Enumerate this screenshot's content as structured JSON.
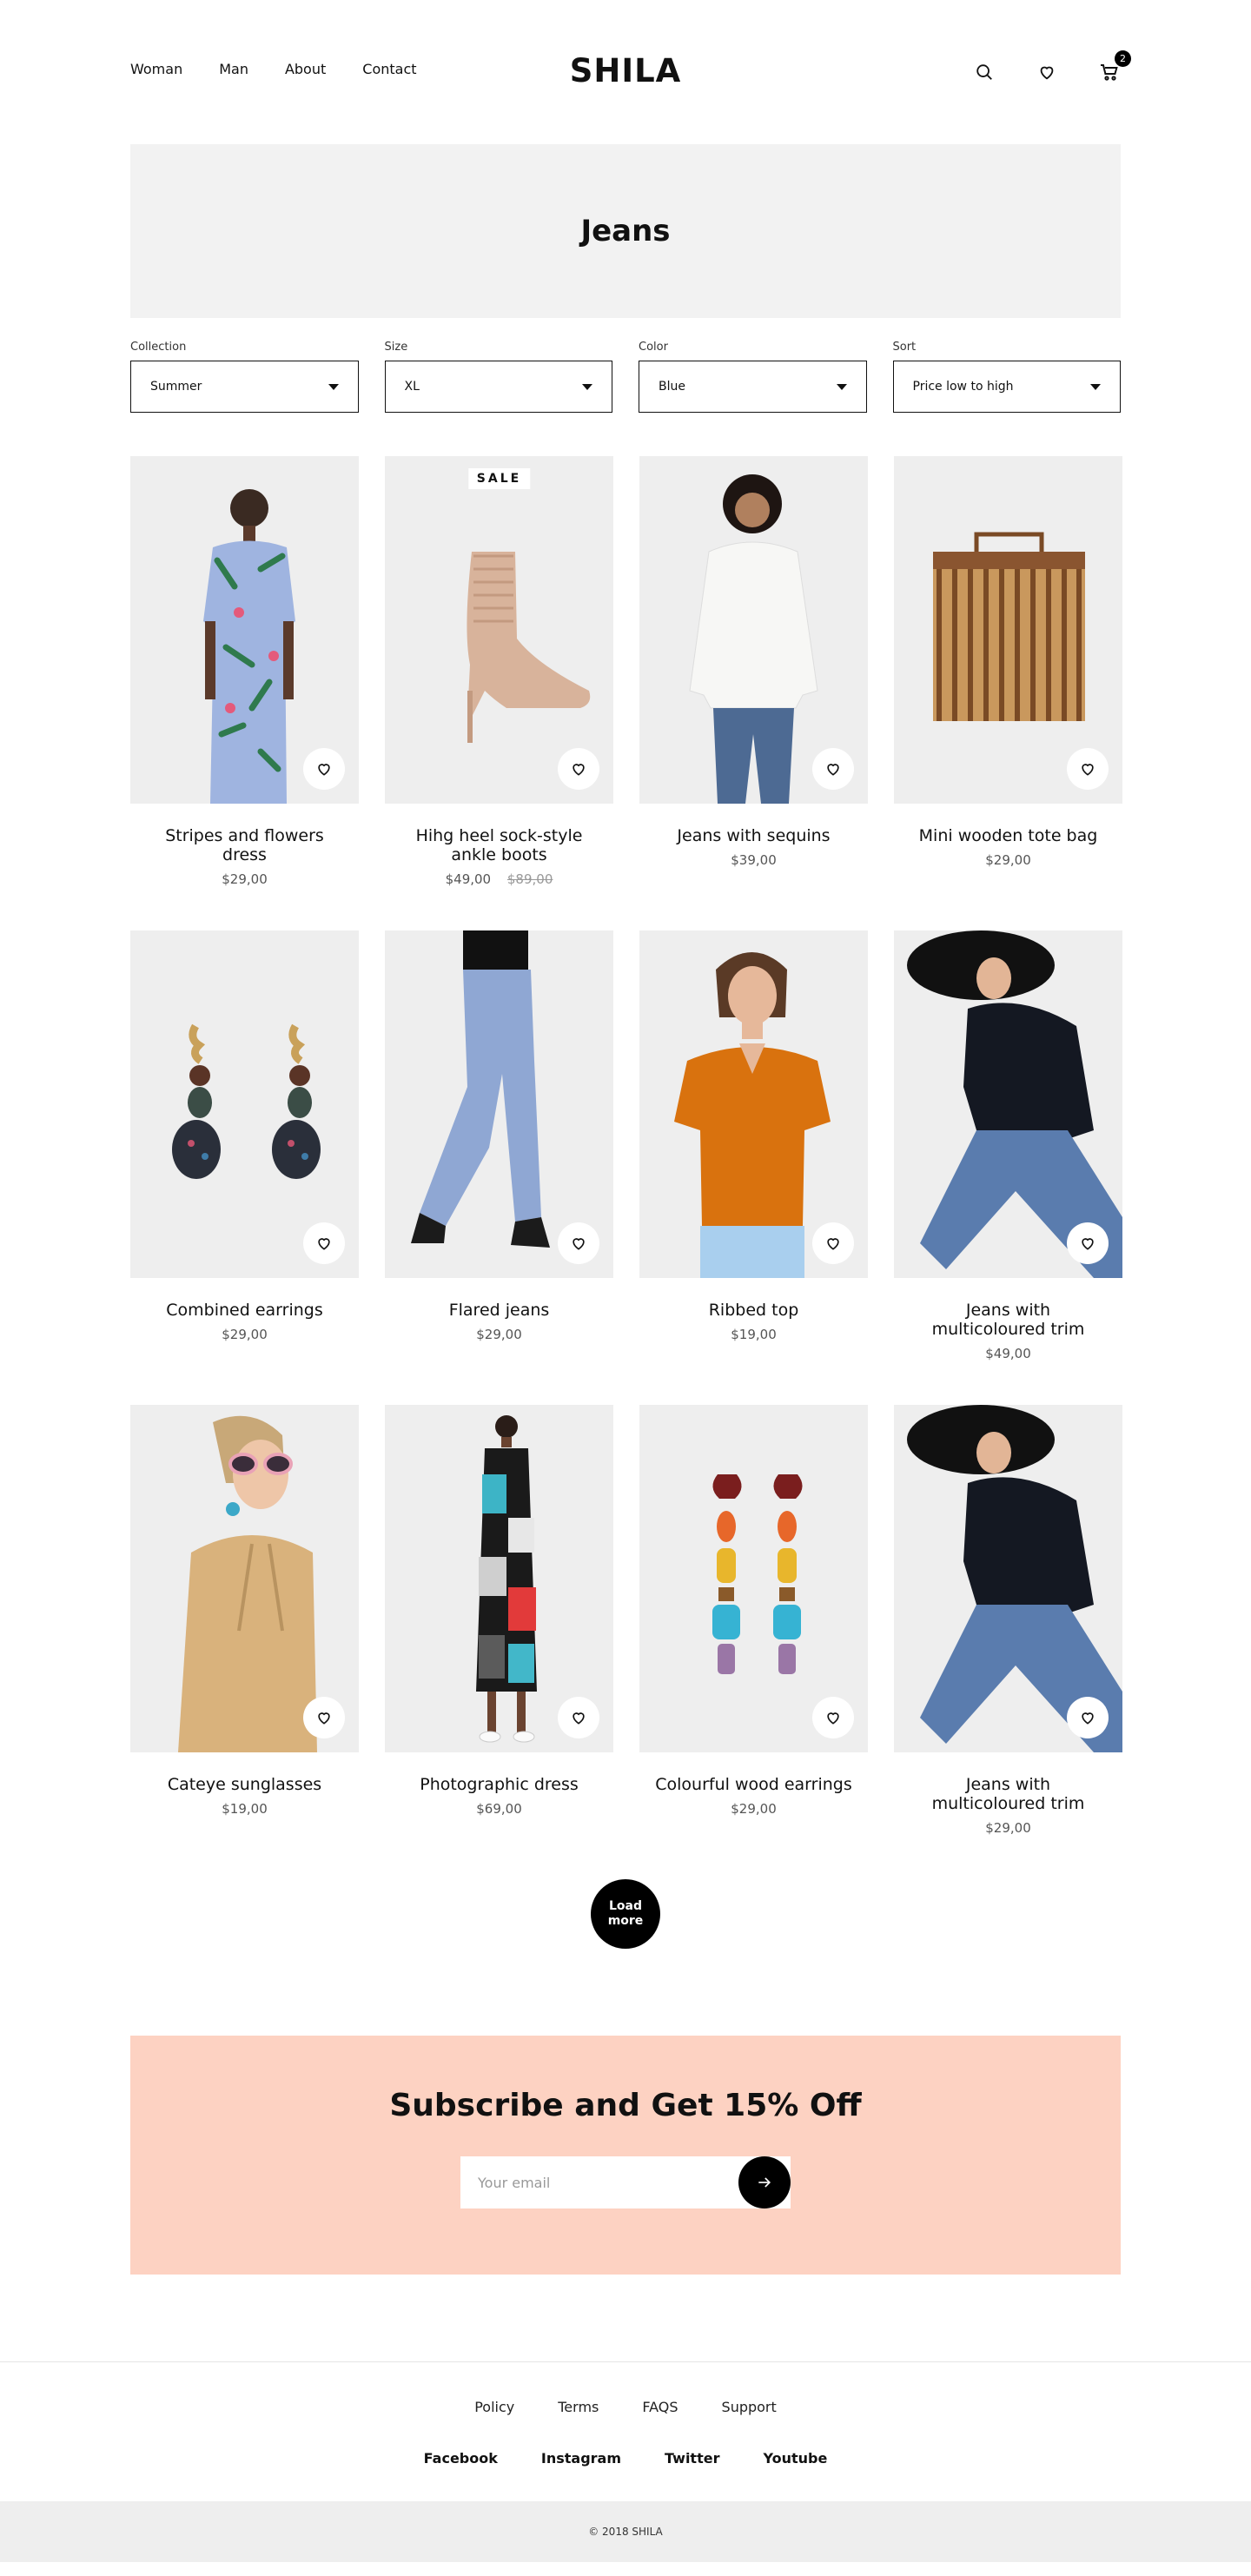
{
  "nav": {
    "items": [
      "Woman",
      "Man",
      "About",
      "Contact"
    ],
    "logo": "SHILA",
    "cart_count": "2"
  },
  "banner": {
    "title": "Jeans"
  },
  "filters": [
    {
      "label": "Collection",
      "value": "Summer"
    },
    {
      "label": "Size",
      "value": "XL"
    },
    {
      "label": "Color",
      "value": "Blue"
    },
    {
      "label": "Sort",
      "value": "Price low to high"
    }
  ],
  "sale_label": "SALE",
  "products": [
    {
      "title": "Stripes and flowers dress",
      "price": "$29,00",
      "old_price": ""
    },
    {
      "title": "Hihg heel sock-style ankle boots",
      "price": "$49,00",
      "old_price": "$89,00"
    },
    {
      "title": "Jeans with sequins",
      "price": "$39,00",
      "old_price": ""
    },
    {
      "title": "Mini wooden tote bag",
      "price": "$29,00",
      "old_price": ""
    },
    {
      "title": "Combined earrings",
      "price": "$29,00",
      "old_price": ""
    },
    {
      "title": "Flared jeans",
      "price": "$29,00",
      "old_price": ""
    },
    {
      "title": "Ribbed top",
      "price": "$19,00",
      "old_price": ""
    },
    {
      "title": "Jeans with multicoloured trim",
      "price": "$49,00",
      "old_price": ""
    },
    {
      "title": "Cateye sunglasses",
      "price": "$19,00",
      "old_price": ""
    },
    {
      "title": "Photographic dress",
      "price": "$69,00",
      "old_price": ""
    },
    {
      "title": "Colourful wood earrings",
      "price": "$29,00",
      "old_price": ""
    },
    {
      "title": "Jeans with multicoloured trim",
      "price": "$29,00",
      "old_price": ""
    }
  ],
  "load_more": "Load more",
  "subscribe": {
    "title": "Subscribe and Get 15% Off",
    "placeholder": "Your email"
  },
  "footer": {
    "links": [
      "Policy",
      "Terms",
      "FAQS",
      "Support"
    ],
    "social": [
      "Facebook",
      "Instagram",
      "Twitter",
      "Youtube"
    ],
    "copyright": "© 2018 SHILA"
  },
  "colors": {
    "accent": "#000000",
    "banner_bg": "#f2f2f2",
    "subscribe_bg": "#fdd2c2"
  }
}
